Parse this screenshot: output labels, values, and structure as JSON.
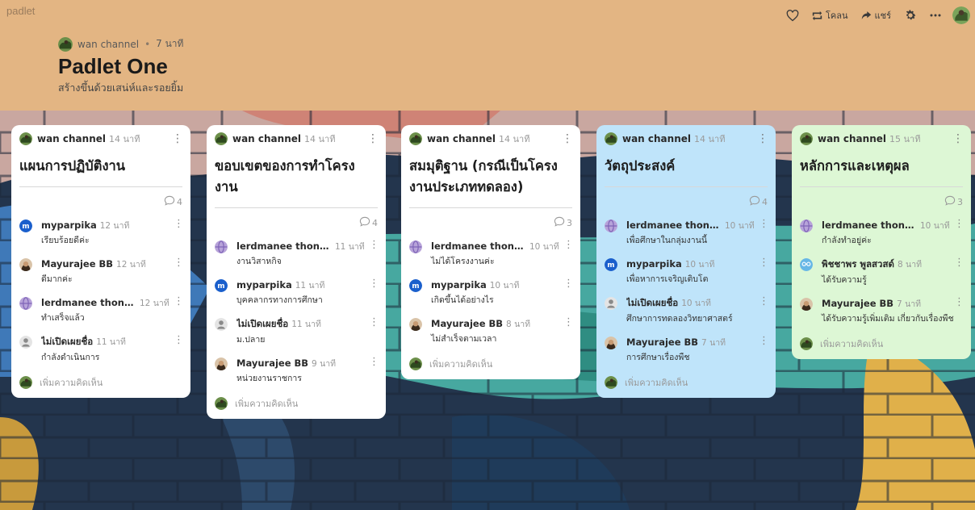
{
  "app": {
    "brand": "padlet"
  },
  "toolbar": {
    "clone_label": "โคลน",
    "share_label": "แชร์",
    "icons": [
      "heart-icon",
      "clone-icon",
      "share-icon",
      "gear-icon",
      "more-icon",
      "user-avatar"
    ]
  },
  "board": {
    "author": "wan channel",
    "separator": "•",
    "time": "7 นาที",
    "title": "Padlet One",
    "description": "สร้างขึ้นด้วยเสน่ห์และรอยยิ้ม"
  },
  "add_comment_placeholder": "เพิ่มความคิดเห็น",
  "colors": {
    "header_bg": "#e3b583",
    "column_white": "#ffffff",
    "column_blue": "#bfe4fa",
    "column_green": "#ddf7d5",
    "badge_blue": "#1a5fcc"
  },
  "columns": [
    {
      "author": "wan channel",
      "time": "14 นาที",
      "title": "แผนการปฏิบัติงาน",
      "count": "4",
      "color": "#ffffff",
      "comments": [
        {
          "avatar": "m",
          "name": "myparpika",
          "time": "12 นาที",
          "text": "เรียบร้อยดีค่ะ"
        },
        {
          "avatar": "face",
          "name": "Mayurajee BB",
          "time": "12 นาที",
          "text": "ดีมากค่ะ"
        },
        {
          "avatar": "globe",
          "name": "lerdmanee thong...",
          "time": "12 นาที",
          "text": "ทำเสร็จแล้ว"
        },
        {
          "avatar": "anon",
          "name": "ไม่เปิดเผยชื่อ",
          "time": "11 นาที",
          "text": "กำลังดำเนินการ"
        }
      ]
    },
    {
      "author": "wan channel",
      "time": "14 นาที",
      "title": "ขอบเขตของการทำโครงงาน",
      "count": "4",
      "color": "#ffffff",
      "comments": [
        {
          "avatar": "globe",
          "name": "lerdmanee thong...",
          "time": "11 นาที",
          "text": "งานวิสาหกิจ"
        },
        {
          "avatar": "m",
          "name": "myparpika",
          "time": "11 นาที",
          "text": "บุคคลากรทางการศึกษา"
        },
        {
          "avatar": "anon",
          "name": "ไม่เปิดเผยชื่อ",
          "time": "11 นาที",
          "text": "ม.ปลาย"
        },
        {
          "avatar": "face",
          "name": "Mayurajee BB",
          "time": "9 นาที",
          "text": "หน่วยงานราชการ"
        }
      ]
    },
    {
      "author": "wan channel",
      "time": "14 นาที",
      "title": "สมมุติฐาน (กรณีเป็นโครงงานประเภททดลอง)",
      "count": "3",
      "color": "#ffffff",
      "comments": [
        {
          "avatar": "globe",
          "name": "lerdmanee thong...",
          "time": "10 นาที",
          "text": "ไม่ได้โครงงานค่ะ"
        },
        {
          "avatar": "m",
          "name": "myparpika",
          "time": "10 นาที",
          "text": "เกิดขึ้นได้อย่างไร"
        },
        {
          "avatar": "face",
          "name": "Mayurajee BB",
          "time": "8 นาที",
          "text": "ไม่สำเร็จตามเวลา"
        }
      ]
    },
    {
      "author": "wan channel",
      "time": "14 นาที",
      "title": "วัตถุประสงค์",
      "count": "4",
      "color": "#bfe4fa",
      "comments": [
        {
          "avatar": "globe",
          "name": "lerdmanee thong...",
          "time": "10 นาที",
          "text": "เพื่อศึกษาในกลุ่มงานนี้"
        },
        {
          "avatar": "m",
          "name": "myparpika",
          "time": "10 นาที",
          "text": "เพื่อหาการเจริญเติบโต"
        },
        {
          "avatar": "anon",
          "name": "ไม่เปิดเผยชื่อ",
          "time": "10 นาที",
          "text": "ศึกษาการทดลองวิทยาศาสตร์"
        },
        {
          "avatar": "face",
          "name": "Mayurajee BB",
          "time": "7 นาที",
          "text": "การศึกษาเรื่องพืช"
        }
      ]
    },
    {
      "author": "wan channel",
      "time": "15 นาที",
      "title": "หลักการและเหตุผล",
      "count": "3",
      "color": "#ddf7d5",
      "comments": [
        {
          "avatar": "globe",
          "name": "lerdmanee thong...",
          "time": "10 นาที",
          "text": "กำลังทำอยู่ค่ะ"
        },
        {
          "avatar": "glasses",
          "name": "พิชชาพร พูลสวสด์",
          "time": "8 นาที",
          "text": "ได้รับความรู้"
        },
        {
          "avatar": "face",
          "name": "Mayurajee BB",
          "time": "7 นาที",
          "text": "ได้รับความรู้เพิ่มเติม เกี่ยวกับเรื่องพืช"
        }
      ]
    }
  ]
}
